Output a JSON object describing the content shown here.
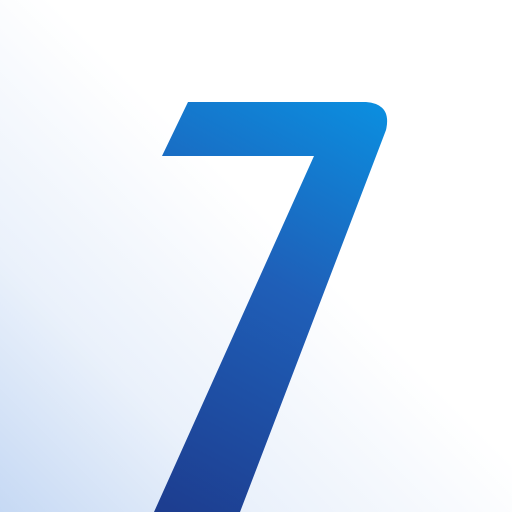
{
  "logo": {
    "glyph": "7",
    "icon": "seven-numeral-logo-icon",
    "colors": {
      "gradient_start": "#0b8fe0",
      "gradient_mid": "#1f5fb8",
      "gradient_end": "#1d3d8f",
      "background": "#ffffff",
      "background_corner": "#c6d9f4"
    }
  }
}
